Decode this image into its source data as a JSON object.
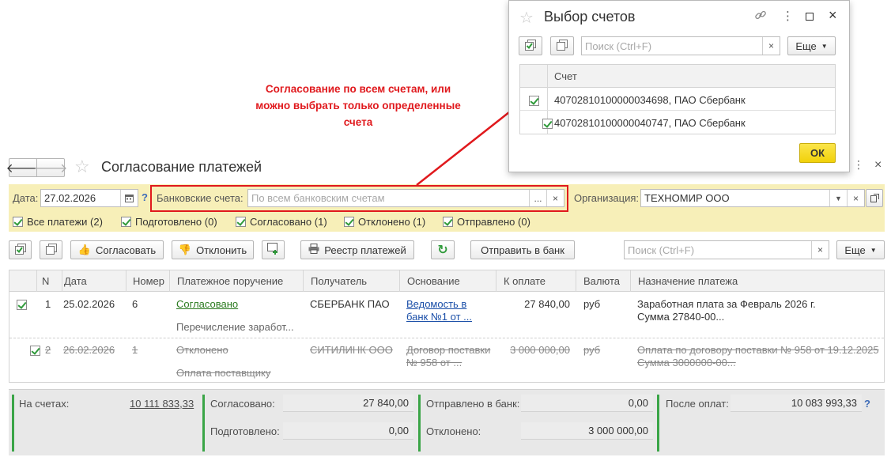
{
  "header": {
    "title": "Согласование платежей",
    "back_icon": "arrow-left-icon",
    "forward_icon": "arrow-right-icon",
    "star_icon": "star-icon",
    "more_icon": "more-vertical-icon",
    "close_glyph": "×"
  },
  "filters": {
    "date_label": "Дата:",
    "date_value": "27.02.2026",
    "help_glyph": "?",
    "bank_accounts_label": "Банковские счета:",
    "bank_accounts_placeholder": "По всем банковским счетам",
    "bank_accounts_select": "...",
    "clear_glyph": "×",
    "org_label": "Организация:",
    "org_value": "ТЕХНОМИР ООО",
    "checkboxes": [
      {
        "label": "Все платежи (2)",
        "checked": true
      },
      {
        "label": "Подготовлено (0)",
        "checked": true
      },
      {
        "label": "Согласовано (1)",
        "checked": true
      },
      {
        "label": "Отклонено (1)",
        "checked": true
      },
      {
        "label": "Отправлено (0)",
        "checked": true
      }
    ]
  },
  "toolbar": {
    "approve": "Согласовать",
    "reject": "Отклонить",
    "registry": "Реестр платежей",
    "send_bank": "Отправить в банк",
    "search_placeholder": "Поиск (Ctrl+F)",
    "more": "Еще"
  },
  "grid": {
    "columns": [
      "N",
      "Дата",
      "Номер",
      "Платежное поручение",
      "Получатель",
      "Основание",
      "К оплате",
      "Валюта",
      "Назначение платежа"
    ],
    "rows": [
      {
        "checked": true,
        "n": "1",
        "date": "25.02.2026",
        "number": "6",
        "status": "Согласовано",
        "order_desc": "Перечисление заработ...",
        "recipient": "СБЕРБАНК ПАО",
        "basis_line1": "Ведомость в",
        "basis_line2": "банк №1 от ...",
        "amount": "27 840,00",
        "currency": "руб",
        "purpose_line1": "Заработная плата за Февраль 2026 г.",
        "purpose_line2": "Сумма 27840-00..."
      },
      {
        "checked": true,
        "n": "2",
        "date": "26.02.2026",
        "number": "1",
        "status": "Отклонено",
        "order_desc": "Оплата поставщику",
        "recipient": "СИТИЛИНК ООО",
        "basis_line1": "Договор поставки",
        "basis_line2": "№ 958 от ...",
        "amount": "3 000 000,00",
        "currency": "руб",
        "purpose_line1": "Оплата по договору поставки № 958 от 19.12.2025",
        "purpose_line2": "Сумма 3000000-00..."
      }
    ]
  },
  "footer": {
    "on_accounts_label": "На счетах:",
    "on_accounts_value": "10 111 833,33",
    "approved_label": "Согласовано:",
    "approved_value": "27 840,00",
    "prepared_label": "Подготовлено:",
    "prepared_value": "0,00",
    "sent_label": "Отправлено в банк:",
    "sent_value": "0,00",
    "rejected_label": "Отклонено:",
    "rejected_value": "3 000 000,00",
    "after_label": "После оплат:",
    "after_value": "10 083 993,33",
    "help_glyph": "?"
  },
  "popup": {
    "title": "Выбор счетов",
    "search_placeholder": "Поиск (Ctrl+F)",
    "more": "Еще",
    "clear_glyph": "×",
    "column": "Счет",
    "accounts": [
      {
        "label": "40702810100000034698, ПАО Сбербанк",
        "checked": true
      },
      {
        "label": "40702810100000040747, ПАО Сбербанк",
        "checked": true
      }
    ],
    "ok": "ОК"
  },
  "annotation": {
    "text": "Согласование по всем счетам, или можно выбрать только определенные счета"
  },
  "colors": {
    "filter_bg": "#f7efb8",
    "accent_red": "#e0191d",
    "ok_yellow": "#f5d90a",
    "check_green": "#2f9a3a",
    "link_blue": "#1b4fa8",
    "footer_bg": "#e8e8e8"
  }
}
